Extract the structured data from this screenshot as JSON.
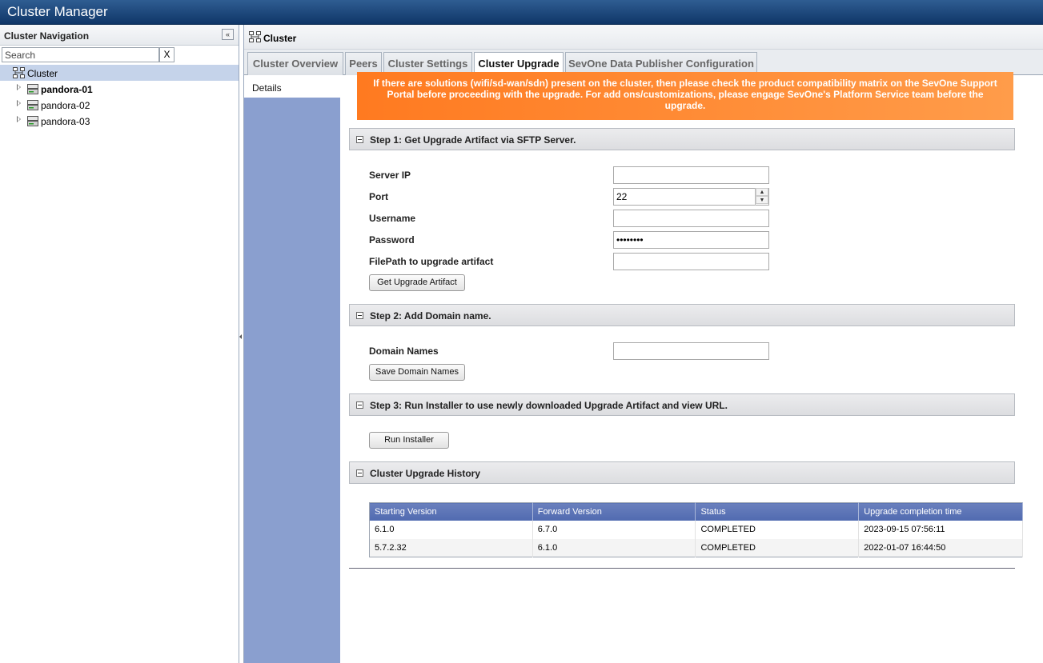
{
  "app": {
    "title": "Cluster Manager"
  },
  "nav": {
    "header": "Cluster Navigation",
    "search_placeholder": "Search",
    "clear_label": "X",
    "tree": [
      {
        "label": "Cluster",
        "icon": "cluster-icon",
        "selected": true
      },
      {
        "label": "pandora-01",
        "icon": "server-icon",
        "bold": true
      },
      {
        "label": "pandora-02",
        "icon": "server-icon"
      },
      {
        "label": "pandora-03",
        "icon": "server-icon"
      }
    ]
  },
  "main": {
    "header": "Cluster",
    "tabs": [
      {
        "label": "Cluster Overview"
      },
      {
        "label": "Peers"
      },
      {
        "label": "Cluster Settings"
      },
      {
        "label": "Cluster Upgrade",
        "active": true
      },
      {
        "label": "SevOne Data Publisher Configuration"
      }
    ],
    "side_item": "Details",
    "warning": "If there are solutions (wifi/sd-wan/sdn) present on the cluster, then please check the product compatibility matrix on the SevOne Support Portal before proceeding with the upgrade. For add ons/customizations, please engage SevOne's Platform Service team before the upgrade.",
    "step1": {
      "title": "Step 1: Get Upgrade Artifact via SFTP Server.",
      "fields": {
        "server_ip": {
          "label": "Server IP",
          "value": ""
        },
        "port": {
          "label": "Port",
          "value": "22"
        },
        "username": {
          "label": "Username",
          "value": ""
        },
        "password": {
          "label": "Password",
          "value": "••••••••"
        },
        "filepath": {
          "label": "FilePath to upgrade artifact",
          "value": ""
        }
      },
      "button": "Get Upgrade Artifact"
    },
    "step2": {
      "title": "Step 2: Add Domain name.",
      "field_label": "Domain Names",
      "field_value": "",
      "button": "Save Domain Names"
    },
    "step3": {
      "title": "Step 3: Run Installer to use newly downloaded Upgrade Artifact and view URL.",
      "button": "Run Installer"
    },
    "history": {
      "title": "Cluster Upgrade History",
      "columns": [
        "Starting Version",
        "Forward Version",
        "Status",
        "Upgrade completion time"
      ],
      "rows": [
        [
          "6.1.0",
          "6.7.0",
          "COMPLETED",
          "2023-09-15 07:56:11"
        ],
        [
          "5.7.2.32",
          "6.1.0",
          "COMPLETED",
          "2022-01-07 16:44:50"
        ]
      ]
    }
  },
  "colors": {
    "titlebar": "#0f3668",
    "warning": "#ff7a20",
    "sidebar": "#8a9fcf",
    "table_header": "#5a72b5"
  }
}
